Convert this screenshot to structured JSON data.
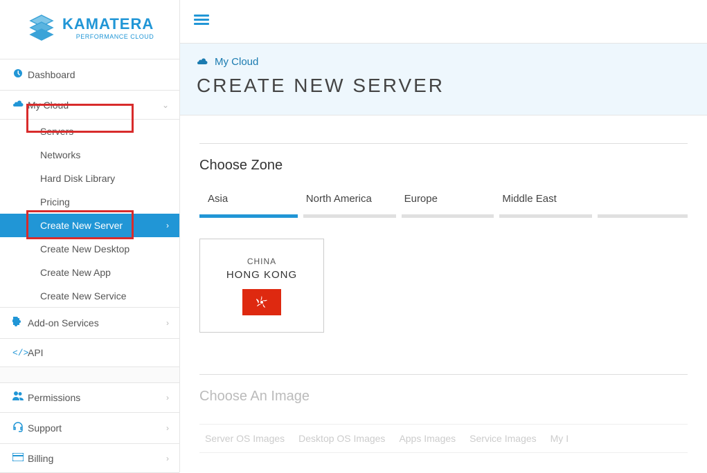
{
  "brand": {
    "name": "KAMATERA",
    "tagline": "PERFORMANCE CLOUD"
  },
  "sidebar": {
    "dashboard": "Dashboard",
    "mycloud": "My Cloud",
    "sub": {
      "servers": "Servers",
      "networks": "Networks",
      "hdl": "Hard Disk Library",
      "pricing": "Pricing",
      "cns": "Create New Server",
      "cnd": "Create New Desktop",
      "cna": "Create New App",
      "cnsvc": "Create New Service"
    },
    "addon": "Add-on Services",
    "api": "API",
    "permissions": "Permissions",
    "support": "Support",
    "billing": "Billing"
  },
  "breadcrumb": "My Cloud",
  "pageTitle": "CREATE NEW SERVER",
  "sections": {
    "zone": "Choose Zone",
    "image": "Choose An Image"
  },
  "zoneTabs": [
    "Asia",
    "North America",
    "Europe",
    "Middle East"
  ],
  "zoneCard": {
    "country": "CHINA",
    "city": "HONG KONG"
  },
  "imageTabs": [
    "Server OS Images",
    "Desktop OS Images",
    "Apps Images",
    "Service Images",
    "My I"
  ],
  "colors": {
    "accent": "#2196d6",
    "highlight": "#d82b2b",
    "flag": "#de2910"
  }
}
